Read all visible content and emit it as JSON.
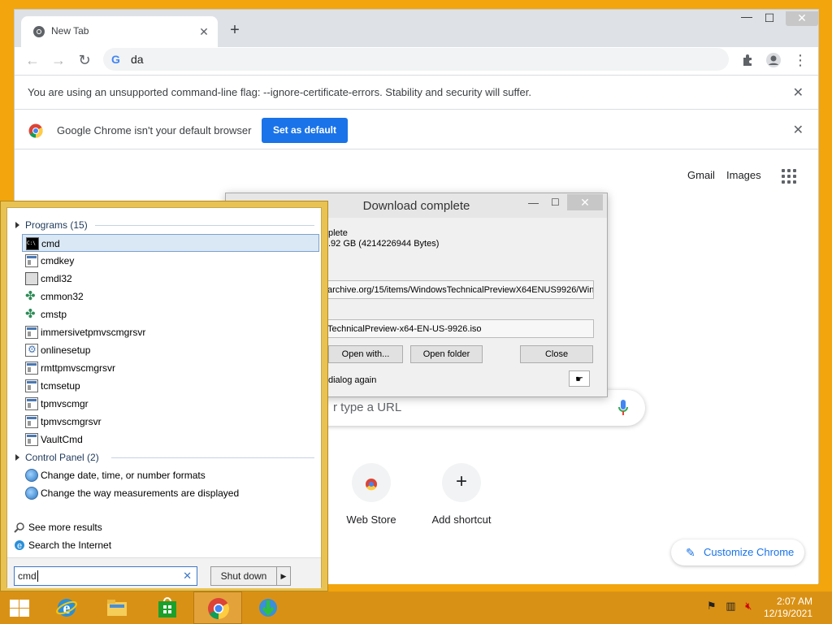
{
  "browser": {
    "tab_title": "New Tab",
    "address_text": "da",
    "info_unsupported": "You are using an unsupported command-line flag: --ignore-certificate-errors. Stability and security will suffer.",
    "info_default": "Google Chrome isn't your default browser",
    "set_default_label": "Set as default"
  },
  "ntp": {
    "gmail": "Gmail",
    "images": "Images",
    "search_placeholder": "r type a URL",
    "shortcuts": [
      {
        "label": "Web Store"
      },
      {
        "label": "Add shortcut"
      }
    ],
    "customize_label": "Customize Chrome"
  },
  "download_dialog": {
    "title": "Download complete",
    "status": "plete",
    "size": ".92  GB (4214226944 Bytes)",
    "url": "archive.org/15/items/WindowsTechnicalPreviewX64ENUS9926/Wind",
    "file": "TechnicalPreview-x64-EN-US-9926.iso",
    "open_with": "Open with...",
    "open_folder": "Open folder",
    "close": "Close",
    "checkbox_text": "dialog again"
  },
  "start_menu": {
    "programs_header": "Programs (15)",
    "programs": [
      {
        "label": "cmd",
        "icon": "cmd-icon"
      },
      {
        "label": "cmdkey",
        "icon": "exe-icon"
      },
      {
        "label": "cmdl32",
        "icon": "tool-icon"
      },
      {
        "label": "cmmon32",
        "icon": "clover-icon"
      },
      {
        "label": "cmstp",
        "icon": "clover-icon"
      },
      {
        "label": "immersivetpmvscmgrsvr",
        "icon": "exe-icon"
      },
      {
        "label": "onlinesetup",
        "icon": "setup-icon"
      },
      {
        "label": "rmttpmvscmgrsvr",
        "icon": "exe-icon"
      },
      {
        "label": "tcmsetup",
        "icon": "exe-icon"
      },
      {
        "label": "tpmvscmgr",
        "icon": "exe-icon"
      },
      {
        "label": "tpmvscmgrsvr",
        "icon": "exe-icon"
      },
      {
        "label": "VaultCmd",
        "icon": "exe-icon"
      }
    ],
    "control_panel_header": "Control Panel (2)",
    "control_panel": [
      {
        "label": "Change date, time, or number formats",
        "icon": "globe-clock-icon"
      },
      {
        "label": "Change the way measurements are displayed",
        "icon": "globe-clock-icon"
      }
    ],
    "see_more": "See more results",
    "search_internet": "Search the Internet",
    "search_value": "cmd",
    "shutdown_label": "Shut down"
  },
  "taskbar": {
    "apps": [
      "internet-explorer-icon",
      "file-explorer-icon",
      "store-icon",
      "chrome-icon",
      "download-manager-icon"
    ],
    "time": "2:07 AM",
    "date": "12/19/2021"
  },
  "colors": {
    "desktop": "#f2a50c",
    "start_menu_frame": "#e8c253",
    "chrome_blue": "#1a73e8",
    "taskbar": "#d99115"
  }
}
